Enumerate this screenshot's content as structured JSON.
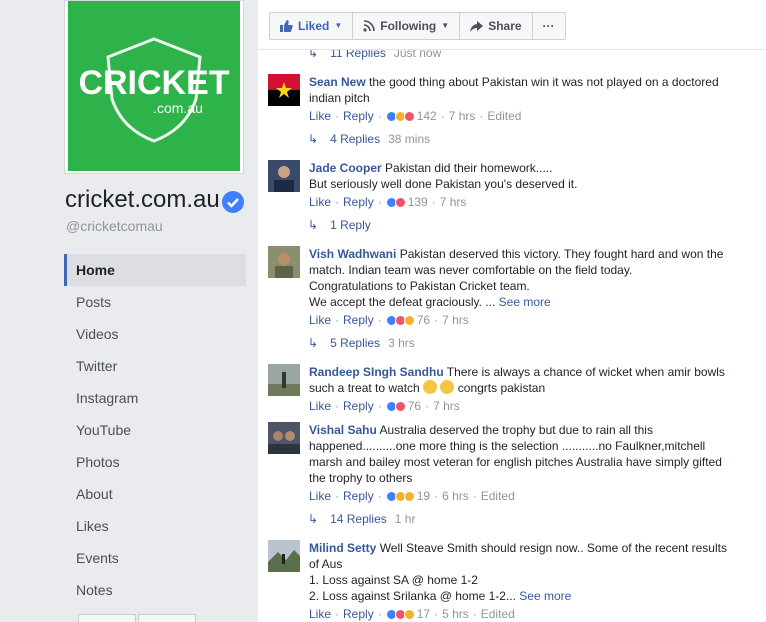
{
  "page": {
    "name": "cricket.com.au",
    "handle": "@cricketcomau",
    "logo_text": "CRICKET",
    "logo_sub": ".com.au",
    "brand_color": "#2db34a"
  },
  "nav": [
    "Home",
    "Posts",
    "Videos",
    "Twitter",
    "Instagram",
    "YouTube",
    "Photos",
    "About",
    "Likes",
    "Events",
    "Notes"
  ],
  "toolbar": {
    "liked": "Liked",
    "following": "Following",
    "share": "Share",
    "more": "···"
  },
  "replies": [
    {
      "label": "11 Replies",
      "time": "Just now"
    },
    {
      "label": "4 Replies",
      "time": "38 mins"
    },
    {
      "label": "1 Reply",
      "time": ""
    },
    {
      "label": "5 Replies",
      "time": "3 hrs"
    },
    {
      "label": "14 Replies",
      "time": "1 hr"
    }
  ],
  "comments": [
    {
      "name": "Sean New",
      "text": "the good thing about Pakistan win it was not played on a doctored indian pitch",
      "count": "142",
      "time": "7 hrs",
      "edited": "Edited",
      "see_more": ""
    },
    {
      "name": "Jade Cooper",
      "text": "Pakistan did their homework.....",
      "text2": "But seriously well done Pakistan you's deserved it.",
      "count": "139",
      "time": "7 hrs",
      "edited": "",
      "see_more": ""
    },
    {
      "name": "Vish Wadhwani",
      "text": "Pakistan deserved this victory. They fought hard and won the match. Indian team was never comfortable on the field today.",
      "text2": "Congratulations to Pakistan Cricket team.",
      "text3": "We accept the defeat graciously. ...",
      "count": "76",
      "time": "7 hrs",
      "edited": "",
      "see_more": "See more"
    },
    {
      "name": "Randeep SIngh Sandhu",
      "text": "There is always a chance of wicket when amir bowls such a treat to watch",
      "text_tail": "congrts pakistan",
      "count": "76",
      "time": "7 hrs",
      "edited": "",
      "see_more": ""
    },
    {
      "name": "Vishal Sahu",
      "text": "Australia deserved the trophy but due to rain all this happened..........one more thing is the selection ...........no Faulkner,mitchell marsh and bailey most veteran for english pitches Australia have simply gifted the trophy to others",
      "count": "19",
      "time": "6 hrs",
      "edited": "Edited",
      "see_more": ""
    },
    {
      "name": "Milind Setty",
      "text": "Well Steave Smith should resign now.. Some of the recent results of Aus",
      "text2": "1. Loss against SA @ home 1-2",
      "text3": "2. Loss against Srilanka @ home 1-2...",
      "count": "17",
      "time": "5 hrs",
      "edited": "Edited",
      "see_more": "See more"
    }
  ],
  "actions": {
    "like": "Like",
    "reply": "Reply"
  }
}
